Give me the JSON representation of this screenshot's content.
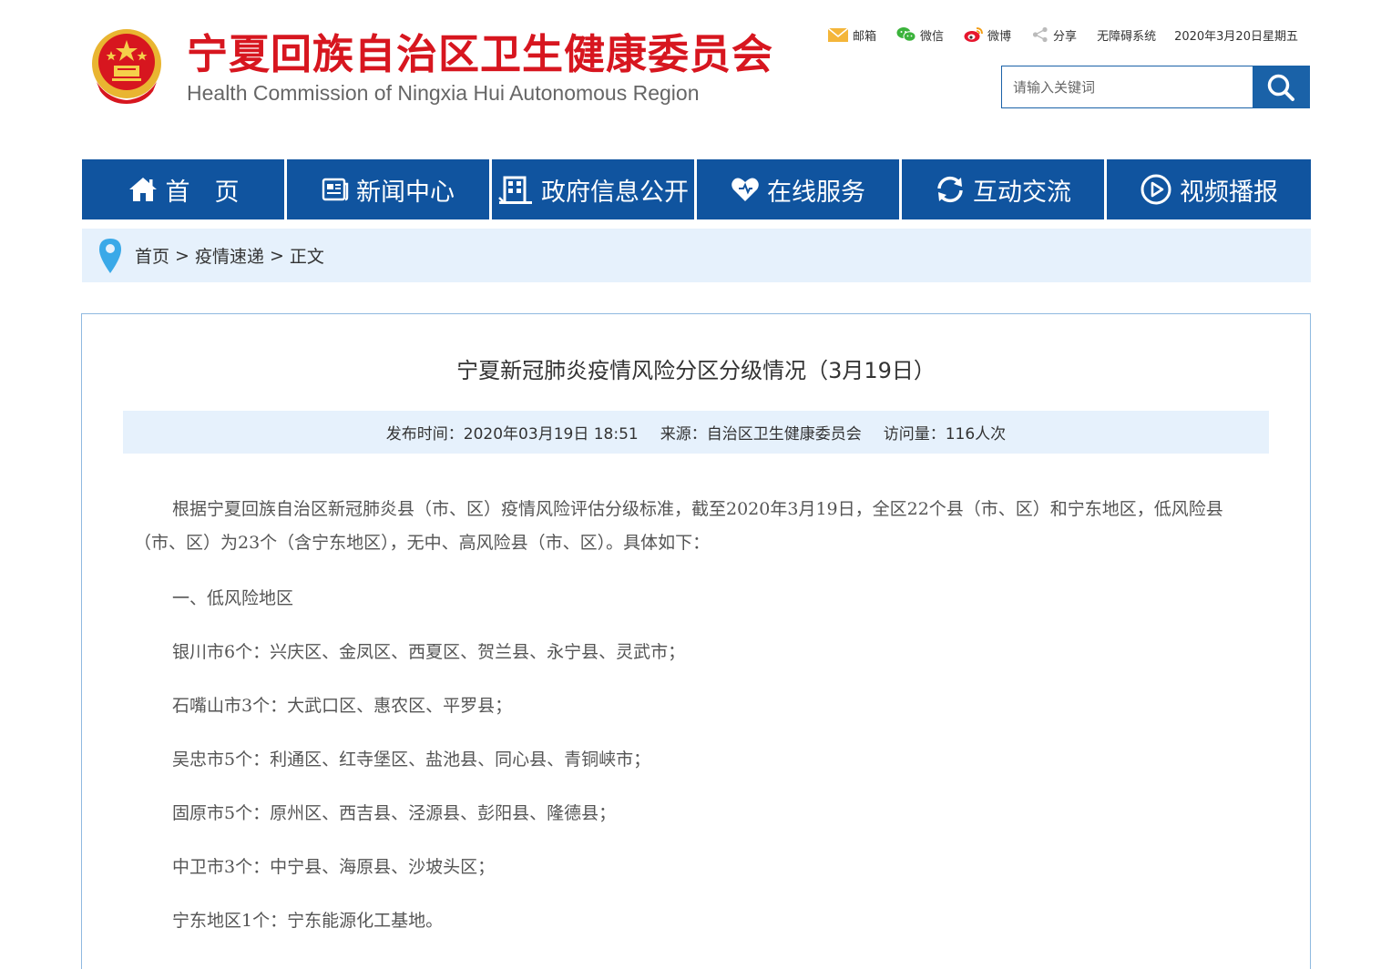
{
  "header": {
    "title_cn": "宁夏回族自治区卫生健康委员会",
    "title_en": "Health Commission of Ningxia Hui Autonomous Region",
    "emblem_icon": "national-emblem",
    "toplinks": [
      {
        "label": "邮箱",
        "icon": "mail-icon"
      },
      {
        "label": "微信",
        "icon": "wechat-icon"
      },
      {
        "label": "微博",
        "icon": "weibo-icon"
      },
      {
        "label": "分享",
        "icon": "share-icon"
      }
    ],
    "accessibility": "无障碍系统",
    "date": "2020年3月20日星期五",
    "search": {
      "placeholder": "请输入关键词"
    }
  },
  "nav": [
    {
      "label": "首　页",
      "icon": "home-icon"
    },
    {
      "label": "新闻中心",
      "icon": "news-icon"
    },
    {
      "label": "政府信息公开",
      "icon": "building-icon"
    },
    {
      "label": "在线服务",
      "icon": "heart-icon"
    },
    {
      "label": "互动交流",
      "icon": "refresh-icon"
    },
    {
      "label": "视频播报",
      "icon": "play-icon"
    }
  ],
  "breadcrumb": {
    "items": [
      "首页",
      "疫情速递",
      "正文"
    ],
    "separator": ">"
  },
  "article": {
    "title": "宁夏新冠肺炎疫情风险分区分级情况（3月19日）",
    "meta": {
      "published": "发布时间：2020年03月19日 18:51",
      "source": "来源：自治区卫生健康委员会",
      "views": "访问量：116人次"
    },
    "paragraphs": [
      "根据宁夏回族自治区新冠肺炎县（市、区）疫情风险评估分级标准，截至2020年3月19日，全区22个县（市、区）和宁东地区，低风险县（市、区）为23个（含宁东地区），无中、高风险县（市、区）。具体如下：",
      "一、低风险地区",
      "银川市6个：兴庆区、金凤区、西夏区、贺兰县、永宁县、灵武市；",
      "石嘴山市3个：大武口区、惠农区、平罗县；",
      "吴忠市5个：利通区、红寺堡区、盐池县、同心县、青铜峡市；",
      "固原市5个：原州区、西吉县、泾源县、彭阳县、隆德县；",
      "中卫市3个：中宁县、海原县、沙坡头区；",
      "宁东地区1个：宁东能源化工基地。"
    ]
  },
  "colors": {
    "brand_red": "#d7161f",
    "nav_blue": "#10549f",
    "light_blue_bg": "#e6f1fc"
  }
}
